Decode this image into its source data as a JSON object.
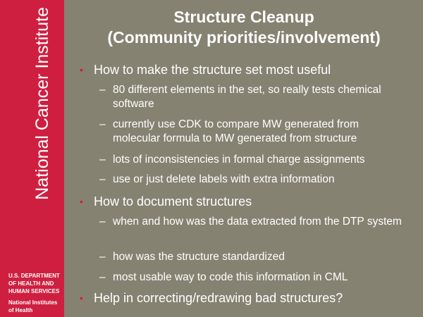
{
  "sidebar": {
    "institute": "National Cancer Institute",
    "hhs_lines": [
      "U.S. DEPARTMENT",
      "OF HEALTH AND",
      "HUMAN SERVICES"
    ],
    "nih_lines": [
      "National Institutes",
      "of Health"
    ],
    "color": "#cf1f40"
  },
  "title": {
    "line1": "Structure Cleanup",
    "line2": "(Community priorities/involvement)"
  },
  "bullets": [
    {
      "text": "How to make the structure set most useful",
      "subs": [
        "80 different elements in the set, so really tests chemical software",
        "currently use CDK to compare MW generated from molecular formula to MW generated from structure",
        "lots of inconsistencies in formal charge assignments",
        "use or just delete labels with extra information"
      ]
    },
    {
      "text": "How to document structures",
      "subs": [
        "when and how was the data extracted from the DTP system",
        "how was the structure standardized",
        "most usable way to code this information in CML"
      ]
    },
    {
      "text": "Help in correcting/redrawing bad structures?",
      "subs": []
    }
  ],
  "colors": {
    "background": "#868272",
    "bullet": "#d7193c",
    "text": "#ffffff"
  }
}
